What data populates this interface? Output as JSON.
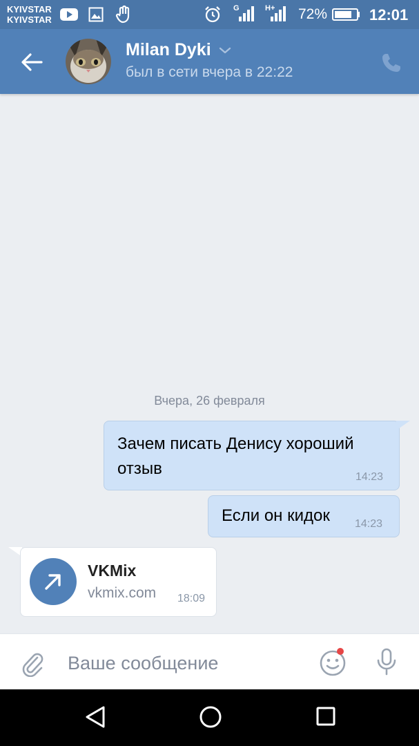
{
  "status_bar": {
    "carrier1": "KYIVSTAR",
    "carrier2": "KYIVSTAR",
    "network_label1": "G",
    "network_label2": "H+",
    "battery_percent": "72%",
    "time": "12:01",
    "icons": [
      "youtube-icon",
      "gallery-icon",
      "hand-icon",
      "alarm-icon",
      "signal-icon",
      "signal-icon",
      "battery-icon"
    ]
  },
  "header": {
    "contact_name": "Milan Dyki",
    "contact_status": "был в сети вчера в 22:22",
    "icons": [
      "back-arrow-icon",
      "chevron-down-icon",
      "phone-icon"
    ]
  },
  "conversation": {
    "date_separator": "Вчера, 26 февраля",
    "messages": [
      {
        "direction": "out",
        "text": "Зачем писать Денису хороший отзыв",
        "time": "14:23"
      },
      {
        "direction": "out",
        "text": "Если он кидок",
        "time": "14:23"
      },
      {
        "direction": "in",
        "type": "link",
        "title": "VKMix",
        "host": "vkmix.com",
        "time": "18:09"
      }
    ]
  },
  "composer": {
    "placeholder": "Ваше сообщение",
    "value": "",
    "icons": [
      "paperclip-icon",
      "emoji-icon",
      "microphone-icon"
    ]
  },
  "nav_bar": {
    "icons": [
      "back-triangle-icon",
      "home-circle-icon",
      "recents-square-icon"
    ]
  },
  "colors": {
    "header": "#5181b8",
    "status_bar": "#4a76a8",
    "background": "#ebeef2",
    "outgoing_bubble": "#cfe2f8",
    "accent": "#5181b8",
    "notification_dot": "#e64646"
  }
}
